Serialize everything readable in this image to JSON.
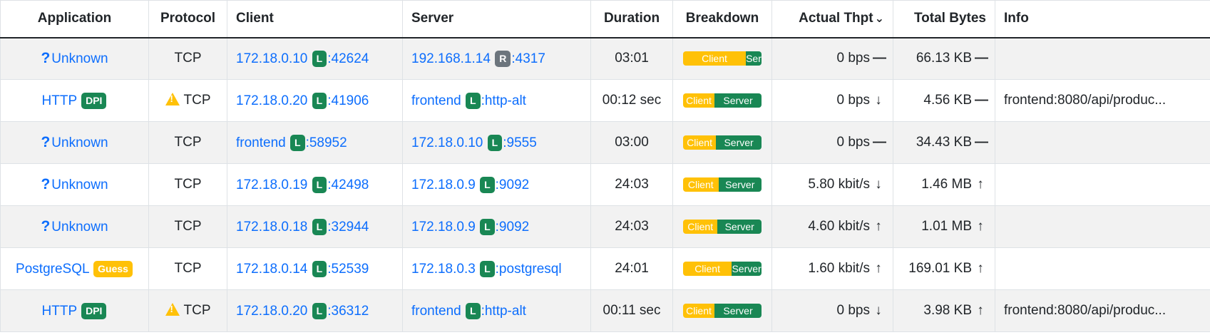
{
  "headers": {
    "application": "Application",
    "protocol": "Protocol",
    "client": "Client",
    "server": "Server",
    "duration": "Duration",
    "breakdown": "Breakdown",
    "thpt": "Actual Thpt",
    "bytes": "Total Bytes",
    "info": "Info"
  },
  "breakdown_labels": {
    "client": "Client",
    "server": "Server"
  },
  "colors": {
    "link": "#0d6efd",
    "local_badge": "#198754",
    "remote_badge": "#6c757d",
    "guess_badge": "#ffc107",
    "client_bar": "#ffc107",
    "server_bar": "#198754",
    "stripe": "#f2f2f2"
  },
  "rows": [
    {
      "app": "Unknown",
      "app_icon": "question-icon",
      "app_badge": "",
      "proto_warn": false,
      "protocol": "TCP",
      "client_host": "172.18.0.10",
      "client_badge": "L",
      "client_port": ":42624",
      "server_host": "192.168.1.14",
      "server_badge": "R",
      "server_port": ":4317",
      "duration": "03:01",
      "client_pct": 80,
      "server_label": "Ser",
      "thpt": "0 bps",
      "thpt_trend": "flat",
      "bytes": "66.13 KB",
      "bytes_trend": "flat",
      "info": ""
    },
    {
      "app": "HTTP",
      "app_icon": "",
      "app_badge": "DPI",
      "proto_warn": true,
      "protocol": "TCP",
      "client_host": "172.18.0.20",
      "client_badge": "L",
      "client_port": ":41906",
      "server_host": "frontend",
      "server_badge": "L",
      "server_port": ":http-alt",
      "duration": "00:12 sec",
      "client_pct": 40,
      "server_label": "Server",
      "thpt": "0 bps",
      "thpt_trend": "down",
      "bytes": "4.56 KB",
      "bytes_trend": "flat",
      "info": "frontend:8080/api/produc..."
    },
    {
      "app": "Unknown",
      "app_icon": "question-icon",
      "app_badge": "",
      "proto_warn": false,
      "protocol": "TCP",
      "client_host": "frontend",
      "client_badge": "L",
      "client_port": ":58952",
      "server_host": "172.18.0.10",
      "server_badge": "L",
      "server_port": ":9555",
      "duration": "03:00",
      "client_pct": 42,
      "server_label": "Server",
      "thpt": "0 bps",
      "thpt_trend": "flat",
      "bytes": "34.43 KB",
      "bytes_trend": "flat",
      "info": ""
    },
    {
      "app": "Unknown",
      "app_icon": "question-icon",
      "app_badge": "",
      "proto_warn": false,
      "protocol": "TCP",
      "client_host": "172.18.0.19",
      "client_badge": "L",
      "client_port": ":42498",
      "server_host": "172.18.0.9",
      "server_badge": "L",
      "server_port": ":9092",
      "duration": "24:03",
      "client_pct": 45,
      "server_label": "Server",
      "thpt": "5.80 kbit/s",
      "thpt_trend": "down",
      "bytes": "1.46 MB",
      "bytes_trend": "up",
      "info": ""
    },
    {
      "app": "Unknown",
      "app_icon": "question-icon",
      "app_badge": "",
      "proto_warn": false,
      "protocol": "TCP",
      "client_host": "172.18.0.18",
      "client_badge": "L",
      "client_port": ":32944",
      "server_host": "172.18.0.9",
      "server_badge": "L",
      "server_port": ":9092",
      "duration": "24:03",
      "client_pct": 44,
      "server_label": "Server",
      "thpt": "4.60 kbit/s",
      "thpt_trend": "up",
      "bytes": "1.01 MB",
      "bytes_trend": "up",
      "info": ""
    },
    {
      "app": "PostgreSQL",
      "app_icon": "",
      "app_badge": "Guess",
      "proto_warn": false,
      "protocol": "TCP",
      "client_host": "172.18.0.14",
      "client_badge": "L",
      "client_port": ":52539",
      "server_host": "172.18.0.3",
      "server_badge": "L",
      "server_port": ":postgresql",
      "duration": "24:01",
      "client_pct": 62,
      "server_label": "Server",
      "thpt": "1.60 kbit/s",
      "thpt_trend": "up",
      "bytes": "169.01 KB",
      "bytes_trend": "up",
      "info": ""
    },
    {
      "app": "HTTP",
      "app_icon": "",
      "app_badge": "DPI",
      "proto_warn": true,
      "protocol": "TCP",
      "client_host": "172.18.0.20",
      "client_badge": "L",
      "client_port": ":36312",
      "server_host": "frontend",
      "server_badge": "L",
      "server_port": ":http-alt",
      "duration": "00:11 sec",
      "client_pct": 40,
      "server_label": "Server",
      "thpt": "0 bps",
      "thpt_trend": "down",
      "bytes": "3.98 KB",
      "bytes_trend": "up",
      "info": "frontend:8080/api/produc..."
    }
  ]
}
